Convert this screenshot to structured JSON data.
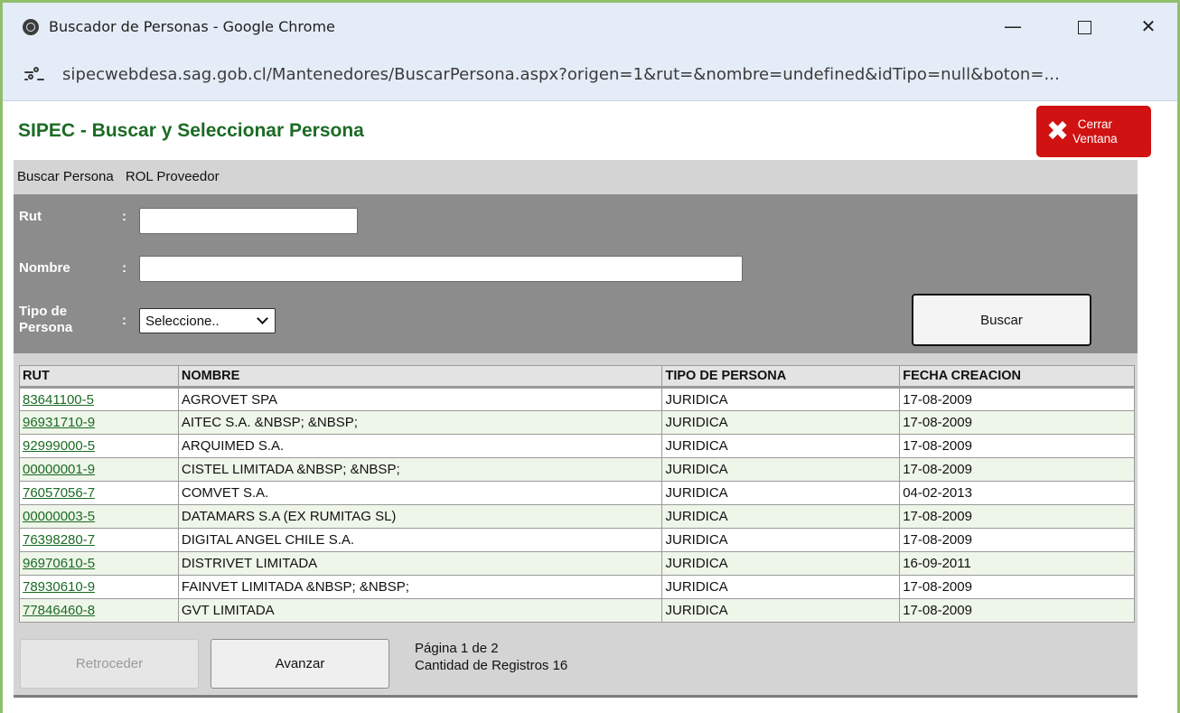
{
  "browser": {
    "window_title": "Buscador de Personas - Google Chrome",
    "minimize_glyph": "—",
    "close_glyph": "✕",
    "url": "sipecwebdesa.sag.gob.cl/Mantenedores/BuscarPersona.aspx?origen=1&rut=&nombre=undefined&idTipo=null&boton=..."
  },
  "page": {
    "title": "SIPEC - Buscar y Seleccionar Persona",
    "close_button": {
      "icon": "x-icon",
      "label_line1": "Cerrar",
      "label_line2": "Ventana",
      "color": "#d11212"
    },
    "section_header": {
      "left": "Buscar Persona",
      "right": "ROL Proveedor"
    }
  },
  "form": {
    "rut_label": "Rut",
    "nombre_label": "Nombre",
    "tipo_label_line1": "Tipo de",
    "tipo_label_line2": "Persona",
    "colon": ":",
    "rut_value": "",
    "nombre_value": "",
    "tipo_selected": "Seleccione..",
    "search_button": "Buscar"
  },
  "results": {
    "columns": [
      "RUT",
      "NOMBRE",
      "TIPO DE PERSONA",
      "FECHA CREACION"
    ],
    "rows": [
      {
        "rut": "83641100-5",
        "nombre": "AGROVET SPA",
        "tipo": "JURIDICA",
        "fecha": "17-08-2009"
      },
      {
        "rut": "96931710-9",
        "nombre": "AITEC S.A. &NBSP; &NBSP;",
        "tipo": "JURIDICA",
        "fecha": "17-08-2009"
      },
      {
        "rut": "92999000-5",
        "nombre": "ARQUIMED S.A.",
        "tipo": "JURIDICA",
        "fecha": "17-08-2009"
      },
      {
        "rut": "00000001-9",
        "nombre": "CISTEL LIMITADA &NBSP; &NBSP;",
        "tipo": "JURIDICA",
        "fecha": "17-08-2009"
      },
      {
        "rut": "76057056-7",
        "nombre": "COMVET S.A.",
        "tipo": "JURIDICA",
        "fecha": "04-02-2013"
      },
      {
        "rut": "00000003-5",
        "nombre": "DATAMARS S.A (EX RUMITAG SL)",
        "tipo": "JURIDICA",
        "fecha": "17-08-2009"
      },
      {
        "rut": "76398280-7",
        "nombre": "DIGITAL ANGEL CHILE S.A.",
        "tipo": "JURIDICA",
        "fecha": "17-08-2009"
      },
      {
        "rut": "96970610-5",
        "nombre": "DISTRIVET LIMITADA",
        "tipo": "JURIDICA",
        "fecha": "16-09-2011"
      },
      {
        "rut": "78930610-9",
        "nombre": "FAINVET LIMITADA &NBSP; &NBSP;",
        "tipo": "JURIDICA",
        "fecha": "17-08-2009"
      },
      {
        "rut": "77846460-8",
        "nombre": "GVT LIMITADA",
        "tipo": "JURIDICA",
        "fecha": "17-08-2009"
      }
    ]
  },
  "pager": {
    "prev_label": "Retroceder",
    "next_label": "Avanzar",
    "page_info": "Página 1 de 2",
    "count_info": "Cantidad de Registros 16"
  },
  "colors": {
    "title_green": "#1b6b24",
    "form_gray": "#8c8c8c",
    "panel_gray": "#d4d4d4",
    "row_alt": "#eef5e9",
    "window_border": "#8fbf6c"
  }
}
